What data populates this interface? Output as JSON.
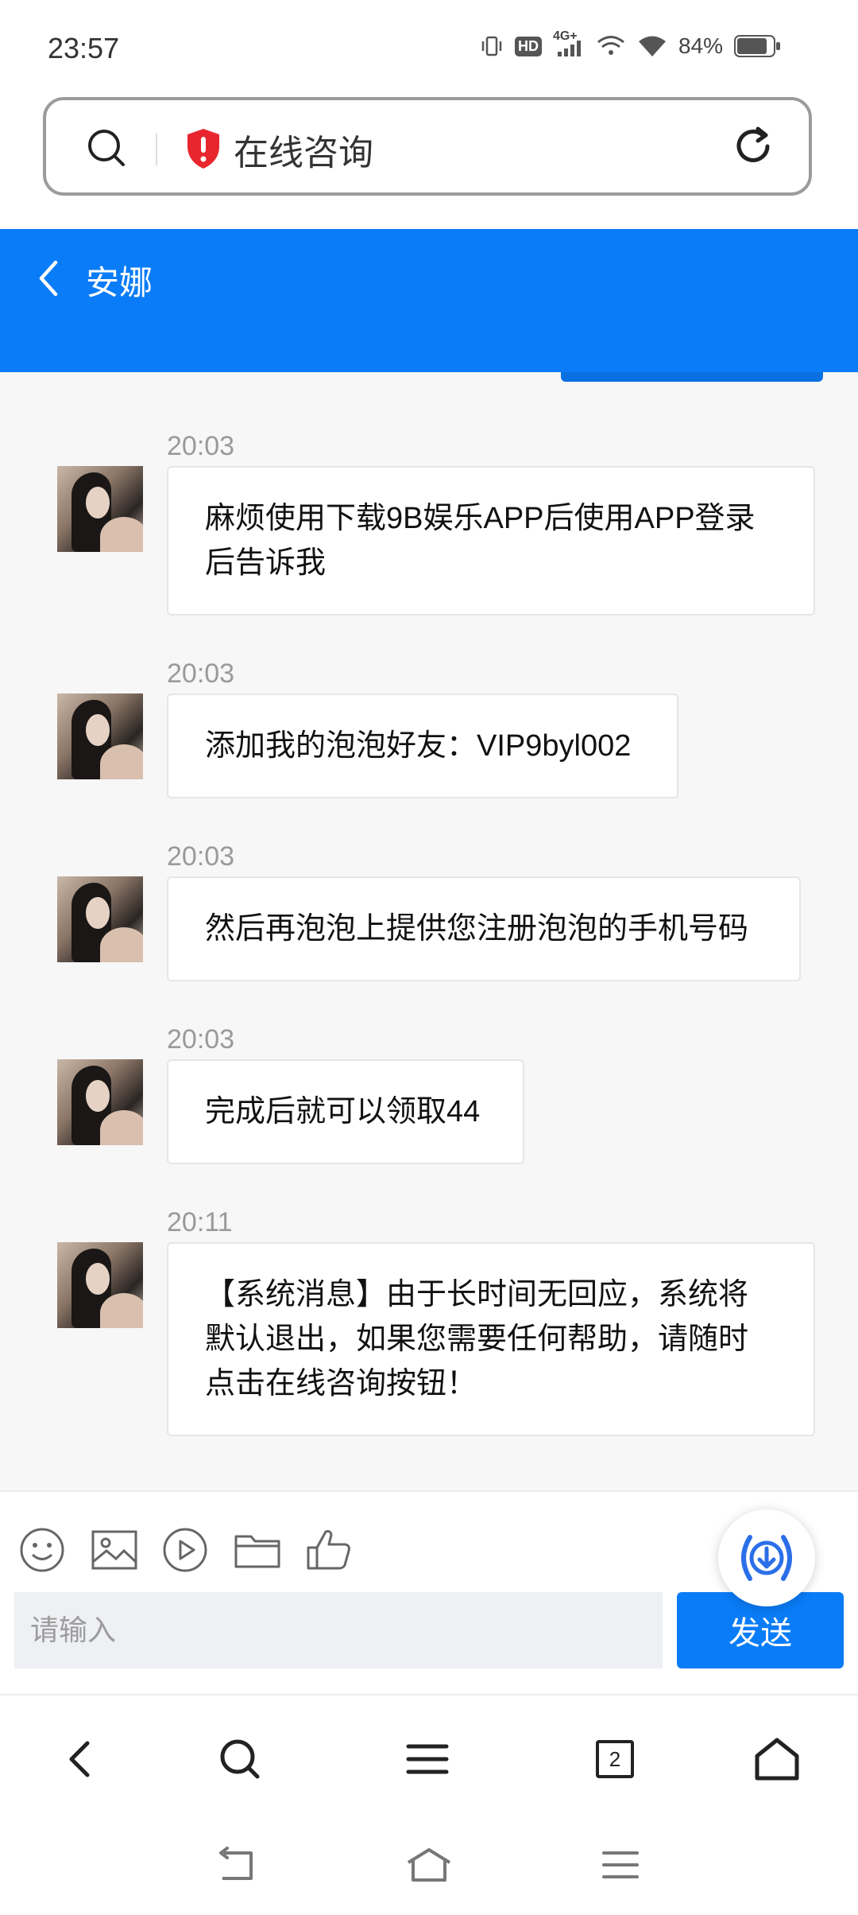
{
  "status_bar": {
    "time": "23:57",
    "network_label": "4G+",
    "hd_label": "HD",
    "battery_percent": "84%",
    "battery_level": 0.84
  },
  "address_bar": {
    "title": "在线咨询",
    "icons": [
      "search-icon",
      "shield-alert-icon",
      "reload-icon"
    ]
  },
  "chat_header": {
    "title": "安娜",
    "accent_color": "#0a7cf7"
  },
  "messages": [
    {
      "time": "20:03",
      "text": "麻烦使用下载9B娱乐APP后使用APP登录后告诉我"
    },
    {
      "time": "20:03",
      "text": "添加我的泡泡好友：VIP9byl002"
    },
    {
      "time": "20:03",
      "text": "然后再泡泡上提供您注册泡泡的手机号码"
    },
    {
      "time": "20:03",
      "text": "完成后就可以领取44"
    },
    {
      "time": "20:11",
      "text": "【系统消息】由于长时间无回应，系统将默认退出，如果您需要任何帮助，请随时点击在线咨询按钮！"
    }
  ],
  "composer": {
    "tools": [
      "emoji-icon",
      "image-icon",
      "video-icon",
      "folder-icon",
      "thumbs-up-icon"
    ],
    "input_placeholder": "请输入",
    "send_label": "发送"
  },
  "browser_nav": {
    "tab_count": "2",
    "items": [
      "back-icon",
      "search-icon",
      "menu-icon",
      "tabs-icon",
      "home-icon"
    ]
  },
  "system_nav": {
    "items": [
      "system-back-icon",
      "system-home-icon",
      "system-recents-icon"
    ]
  }
}
